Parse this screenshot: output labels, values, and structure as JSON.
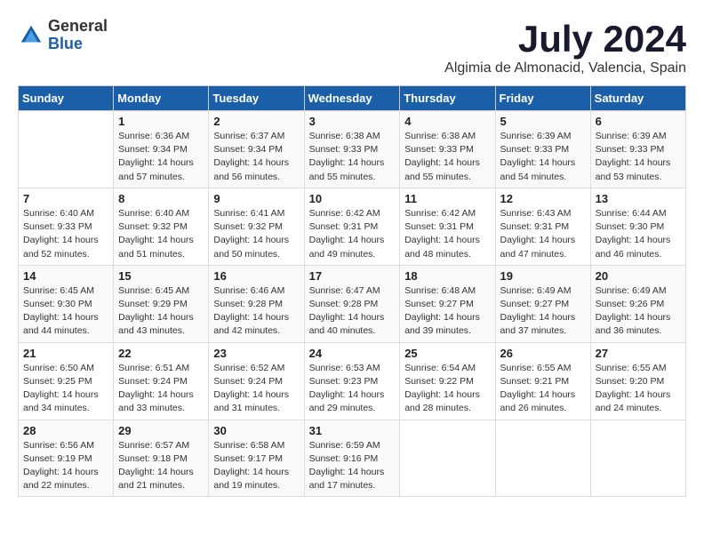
{
  "header": {
    "logo_general": "General",
    "logo_blue": "Blue",
    "month": "July 2024",
    "location": "Algimia de Almonacid, Valencia, Spain"
  },
  "weekdays": [
    "Sunday",
    "Monday",
    "Tuesday",
    "Wednesday",
    "Thursday",
    "Friday",
    "Saturday"
  ],
  "weeks": [
    [
      {
        "day": "",
        "info": ""
      },
      {
        "day": "1",
        "info": "Sunrise: 6:36 AM\nSunset: 9:34 PM\nDaylight: 14 hours\nand 57 minutes."
      },
      {
        "day": "2",
        "info": "Sunrise: 6:37 AM\nSunset: 9:34 PM\nDaylight: 14 hours\nand 56 minutes."
      },
      {
        "day": "3",
        "info": "Sunrise: 6:38 AM\nSunset: 9:33 PM\nDaylight: 14 hours\nand 55 minutes."
      },
      {
        "day": "4",
        "info": "Sunrise: 6:38 AM\nSunset: 9:33 PM\nDaylight: 14 hours\nand 55 minutes."
      },
      {
        "day": "5",
        "info": "Sunrise: 6:39 AM\nSunset: 9:33 PM\nDaylight: 14 hours\nand 54 minutes."
      },
      {
        "day": "6",
        "info": "Sunrise: 6:39 AM\nSunset: 9:33 PM\nDaylight: 14 hours\nand 53 minutes."
      }
    ],
    [
      {
        "day": "7",
        "info": "Sunrise: 6:40 AM\nSunset: 9:33 PM\nDaylight: 14 hours\nand 52 minutes."
      },
      {
        "day": "8",
        "info": "Sunrise: 6:40 AM\nSunset: 9:32 PM\nDaylight: 14 hours\nand 51 minutes."
      },
      {
        "day": "9",
        "info": "Sunrise: 6:41 AM\nSunset: 9:32 PM\nDaylight: 14 hours\nand 50 minutes."
      },
      {
        "day": "10",
        "info": "Sunrise: 6:42 AM\nSunset: 9:31 PM\nDaylight: 14 hours\nand 49 minutes."
      },
      {
        "day": "11",
        "info": "Sunrise: 6:42 AM\nSunset: 9:31 PM\nDaylight: 14 hours\nand 48 minutes."
      },
      {
        "day": "12",
        "info": "Sunrise: 6:43 AM\nSunset: 9:31 PM\nDaylight: 14 hours\nand 47 minutes."
      },
      {
        "day": "13",
        "info": "Sunrise: 6:44 AM\nSunset: 9:30 PM\nDaylight: 14 hours\nand 46 minutes."
      }
    ],
    [
      {
        "day": "14",
        "info": "Sunrise: 6:45 AM\nSunset: 9:30 PM\nDaylight: 14 hours\nand 44 minutes."
      },
      {
        "day": "15",
        "info": "Sunrise: 6:45 AM\nSunset: 9:29 PM\nDaylight: 14 hours\nand 43 minutes."
      },
      {
        "day": "16",
        "info": "Sunrise: 6:46 AM\nSunset: 9:28 PM\nDaylight: 14 hours\nand 42 minutes."
      },
      {
        "day": "17",
        "info": "Sunrise: 6:47 AM\nSunset: 9:28 PM\nDaylight: 14 hours\nand 40 minutes."
      },
      {
        "day": "18",
        "info": "Sunrise: 6:48 AM\nSunset: 9:27 PM\nDaylight: 14 hours\nand 39 minutes."
      },
      {
        "day": "19",
        "info": "Sunrise: 6:49 AM\nSunset: 9:27 PM\nDaylight: 14 hours\nand 37 minutes."
      },
      {
        "day": "20",
        "info": "Sunrise: 6:49 AM\nSunset: 9:26 PM\nDaylight: 14 hours\nand 36 minutes."
      }
    ],
    [
      {
        "day": "21",
        "info": "Sunrise: 6:50 AM\nSunset: 9:25 PM\nDaylight: 14 hours\nand 34 minutes."
      },
      {
        "day": "22",
        "info": "Sunrise: 6:51 AM\nSunset: 9:24 PM\nDaylight: 14 hours\nand 33 minutes."
      },
      {
        "day": "23",
        "info": "Sunrise: 6:52 AM\nSunset: 9:24 PM\nDaylight: 14 hours\nand 31 minutes."
      },
      {
        "day": "24",
        "info": "Sunrise: 6:53 AM\nSunset: 9:23 PM\nDaylight: 14 hours\nand 29 minutes."
      },
      {
        "day": "25",
        "info": "Sunrise: 6:54 AM\nSunset: 9:22 PM\nDaylight: 14 hours\nand 28 minutes."
      },
      {
        "day": "26",
        "info": "Sunrise: 6:55 AM\nSunset: 9:21 PM\nDaylight: 14 hours\nand 26 minutes."
      },
      {
        "day": "27",
        "info": "Sunrise: 6:55 AM\nSunset: 9:20 PM\nDaylight: 14 hours\nand 24 minutes."
      }
    ],
    [
      {
        "day": "28",
        "info": "Sunrise: 6:56 AM\nSunset: 9:19 PM\nDaylight: 14 hours\nand 22 minutes."
      },
      {
        "day": "29",
        "info": "Sunrise: 6:57 AM\nSunset: 9:18 PM\nDaylight: 14 hours\nand 21 minutes."
      },
      {
        "day": "30",
        "info": "Sunrise: 6:58 AM\nSunset: 9:17 PM\nDaylight: 14 hours\nand 19 minutes."
      },
      {
        "day": "31",
        "info": "Sunrise: 6:59 AM\nSunset: 9:16 PM\nDaylight: 14 hours\nand 17 minutes."
      },
      {
        "day": "",
        "info": ""
      },
      {
        "day": "",
        "info": ""
      },
      {
        "day": "",
        "info": ""
      }
    ]
  ]
}
